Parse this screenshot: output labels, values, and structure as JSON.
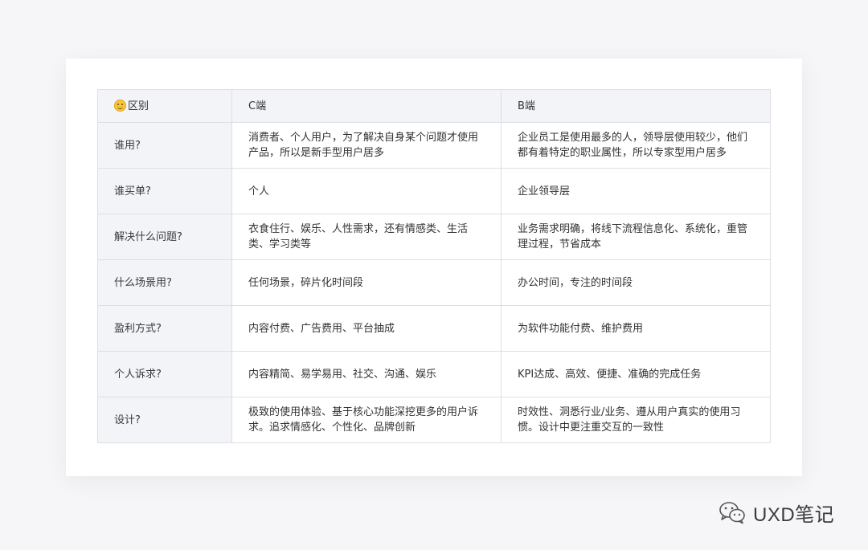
{
  "table": {
    "headers": [
      "区别",
      "C端",
      "B端"
    ],
    "rows": [
      {
        "label": "谁用?",
        "c": "消费者、个人用户，为了解决自身某个问题才使用产品，所以是新手型用户居多",
        "b": "企业员工是使用最多的人，领导层使用较少，他们都有着特定的职业属性，所以专家型用户居多"
      },
      {
        "label": "谁买单?",
        "c": "个人",
        "b": "企业领导层"
      },
      {
        "label": "解决什么问题?",
        "c": "衣食住行、娱乐、人性需求，还有情感类、生活类、学习类等",
        "b": "业务需求明确，将线下流程信息化、系统化，重管理过程，节省成本"
      },
      {
        "label": "什么场景用?",
        "c": "任何场景，碎片化时间段",
        "b": "办公时间，专注的时间段"
      },
      {
        "label": "盈利方式?",
        "c": "内容付费、广告费用、平台抽成",
        "b": "为软件功能付费、维护费用"
      },
      {
        "label": "个人诉求?",
        "c": "内容精简、易学易用、社交、沟通、娱乐",
        "b": "KPI达成、高效、便捷、准确的完成任务"
      },
      {
        "label": "设计?",
        "c": "极致的使用体验、基于核心功能深挖更多的用户诉求。追求情感化、个性化、品牌创新",
        "b": "时效性、洞悉行业/业务、遵从用户真实的使用习惯。设计中更注重交互的一致性"
      }
    ]
  },
  "watermark": {
    "text": "UXD笔记",
    "icon": "wechat-icon"
  }
}
